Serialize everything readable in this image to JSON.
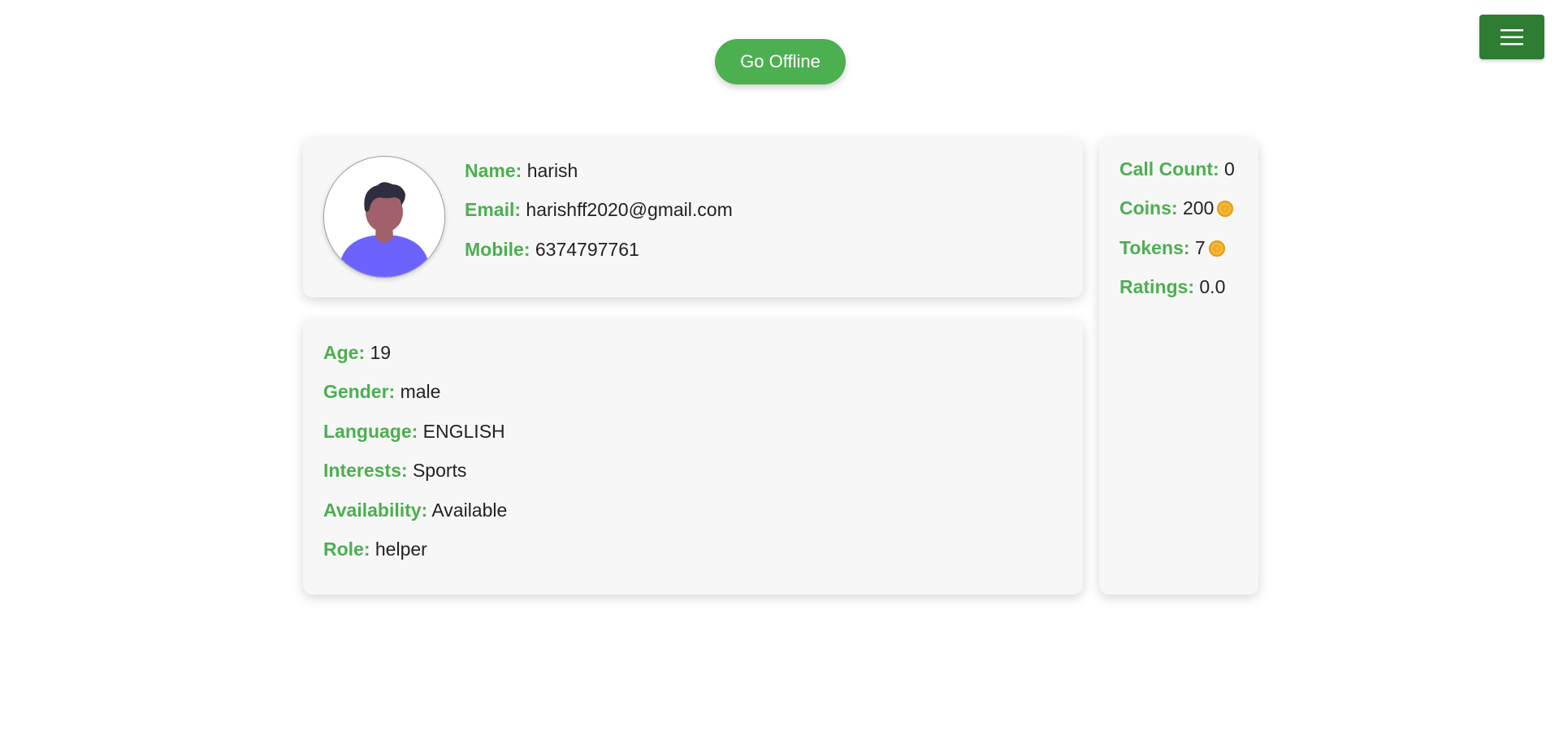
{
  "header": {
    "go_offline_label": "Go Offline",
    "menu_icon": "hamburger-menu-icon",
    "accent_color": "#4caf50",
    "menu_color": "#2e7d32"
  },
  "profile": {
    "avatar_icon": "user-avatar-icon",
    "name_label": "Name:",
    "name_value": "harish",
    "email_label": "Email:",
    "email_value": "harishff2020@gmail.com",
    "mobile_label": "Mobile:",
    "mobile_value": "6374797761"
  },
  "details": {
    "age_label": "Age:",
    "age_value": "19",
    "gender_label": "Gender:",
    "gender_value": "male",
    "language_label": "Language:",
    "language_value": "ENGLISH",
    "interests_label": "Interests:",
    "interests_value": "Sports",
    "availability_label": "Availability:",
    "availability_value": "Available",
    "role_label": "Role:",
    "role_value": "helper"
  },
  "stats": {
    "call_count_label": "Call Count:",
    "call_count_value": "0",
    "coins_label": "Coins:",
    "coins_value": "200",
    "tokens_label": "Tokens:",
    "tokens_value": "7",
    "ratings_label": "Ratings:",
    "ratings_value": "0.0",
    "coin_icon": "coin-icon"
  }
}
